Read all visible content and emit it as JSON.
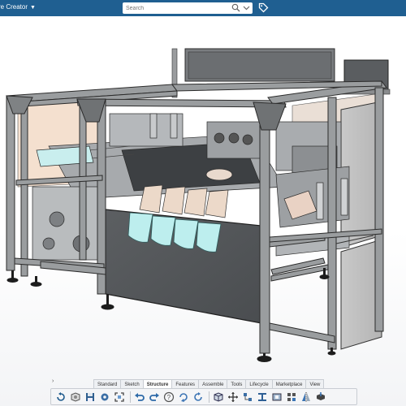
{
  "header": {
    "app_title": "re Creator",
    "search_placeholder": "Search"
  },
  "icons": {
    "app_menu": "chevron-down-icon",
    "search": "magnifier-icon",
    "search_dropdown": "chevron-down-icon",
    "tag": "tag-icon"
  },
  "colors": {
    "topbar": "#1f5f91",
    "frame": "#8f9294",
    "guard_panel": "#5f6265",
    "accent_teal": "#b8ecec",
    "tan_panel": "#f0dccb"
  },
  "section_tabs": [
    {
      "label": "Standard"
    },
    {
      "label": "Sketch"
    },
    {
      "label": "Structure",
      "active": true
    },
    {
      "label": "Features"
    },
    {
      "label": "Assemble"
    },
    {
      "label": "Tools"
    },
    {
      "label": "Lifecycle"
    },
    {
      "label": "Marketplace"
    },
    {
      "label": "View"
    }
  ],
  "action_bar": {
    "more": "›",
    "tools": [
      "undo-loop-icon",
      "part-icon",
      "save-icon",
      "settings-gear-icon",
      "fit-all-icon",
      "help-icon",
      "undo-icon",
      "redo-icon",
      "cube-view-icon",
      "move-icon",
      "structure-icon",
      "beam-icon",
      "profile-icon",
      "pattern-icon",
      "mirror-icon",
      "extrude-icon",
      "align-icon"
    ]
  }
}
